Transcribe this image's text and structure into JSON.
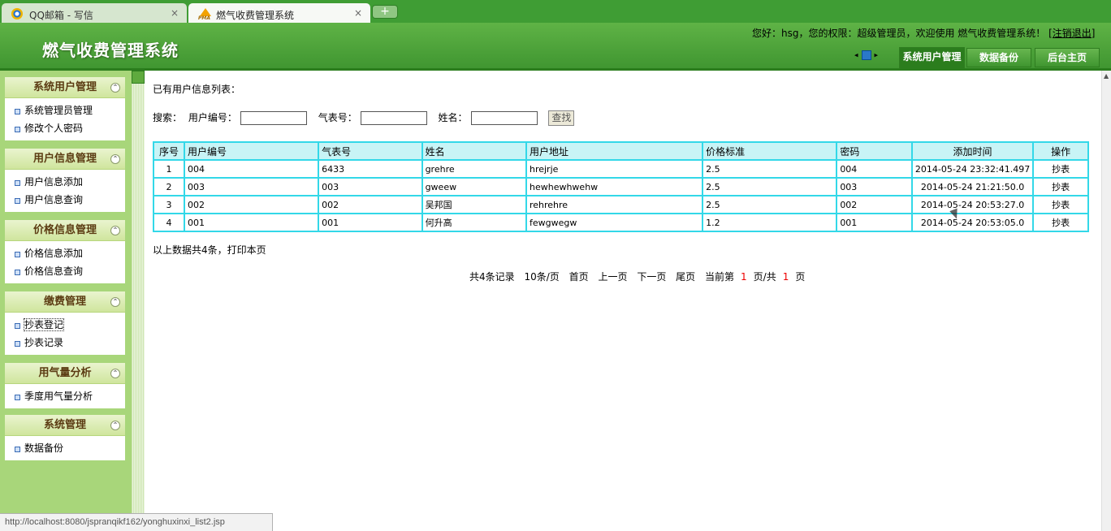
{
  "browser": {
    "tabs": [
      {
        "title": "QQ邮箱 - 写信",
        "close": "×"
      },
      {
        "title": "燃气收费管理系统",
        "icon_text": "PMA",
        "close": "×"
      }
    ],
    "new_tab": "+",
    "status_url": "http://localhost:8080/jspranqikf162/yonghuxinxi_list2.jsp"
  },
  "header": {
    "app_title": "燃气收费管理系统",
    "welcome": "您好：hsg，您的权限：超级管理员，欢迎使用 燃气收费管理系统！",
    "logout": "[注销退出]",
    "nav_prev": "◂",
    "nav_next": "▸",
    "nav_buttons": [
      "系统用户管理",
      "数据备份",
      "后台主页"
    ]
  },
  "sidebar": {
    "collapse_glyph": "⌃",
    "groups": [
      {
        "title": "系统用户管理",
        "items": [
          "系统管理员管理",
          "修改个人密码"
        ]
      },
      {
        "title": "用户信息管理",
        "items": [
          "用户信息添加",
          "用户信息查询"
        ]
      },
      {
        "title": "价格信息管理",
        "items": [
          "价格信息添加",
          "价格信息查询"
        ]
      },
      {
        "title": "缴费管理",
        "items": [
          "抄表登记",
          "抄表记录"
        ]
      },
      {
        "title": "用气量分析",
        "items": [
          "季度用气量分析"
        ]
      },
      {
        "title": "系统管理",
        "items": [
          "数据备份"
        ]
      }
    ]
  },
  "main": {
    "list_title": "已有用户信息列表：",
    "search": {
      "label": "搜索：",
      "user_no_label": "用户编号：",
      "meter_no_label": "气表号：",
      "name_label": "姓名：",
      "user_no_value": "",
      "meter_no_value": "",
      "name_value": "",
      "button": "查找"
    },
    "table": {
      "headers": [
        "序号",
        "用户编号",
        "气表号",
        "姓名",
        "用户地址",
        "价格标准",
        "密码",
        "添加时间",
        "操作"
      ],
      "rows": [
        [
          "1",
          "004",
          "6433",
          "grehre",
          "hrejrje",
          "2.5",
          "004",
          "2014-05-24 23:32:41.497",
          "抄表"
        ],
        [
          "2",
          "003",
          "003",
          "gweew",
          "hewhewhwehw",
          "2.5",
          "003",
          "2014-05-24 21:21:50.0",
          "抄表"
        ],
        [
          "3",
          "002",
          "002",
          "吴邦国",
          "rehrehre",
          "2.5",
          "002",
          "2014-05-24 20:53:27.0",
          "抄表"
        ],
        [
          "4",
          "001",
          "001",
          "何升高",
          "fewgwegw",
          "1.2",
          "001",
          "2014-05-24 20:53:05.0",
          "抄表"
        ]
      ]
    },
    "summary": "以上数据共4条，打印本页",
    "pager": {
      "total": "共4条记录",
      "per_page": "10条/页",
      "first": "首页",
      "prev": "上一页",
      "next": "下一页",
      "last": "尾页",
      "current_prefix": "当前第",
      "current_page": "1",
      "current_mid": "页/共",
      "total_pages": "1",
      "current_suffix": "页"
    }
  }
}
